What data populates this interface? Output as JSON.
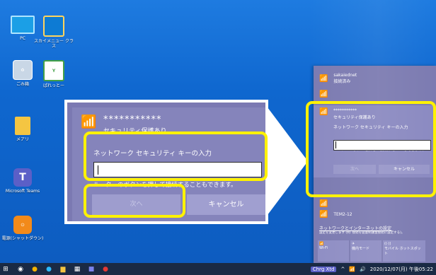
{
  "desktop": {
    "icons": [
      {
        "label": "PC",
        "icon": "pc-icon"
      },
      {
        "label": "スカイメニュー クラス",
        "icon": "sky-menu-icon"
      },
      {
        "label": "ごみ箱",
        "icon": "recycle-bin-icon"
      },
      {
        "label": "ぱれっとー",
        "icon": "green-app-icon"
      },
      {
        "label": "メアリ",
        "icon": "folder-icon"
      },
      {
        "label": "Microsoft Teams",
        "icon": "teams-icon"
      },
      {
        "label": "電源(シャットダウン)",
        "icon": "power-icon"
      }
    ]
  },
  "flyout": {
    "networks": [
      {
        "name": "sakaiednet",
        "status": "接続済み"
      },
      {
        "name": "TEM2-12",
        "status": ""
      }
    ],
    "selected": {
      "ssid": "***********",
      "security": "セキュリティ保護あり",
      "prompt": "ネットワーク セキュリティ キーの入力",
      "hint": "ルーターのボタンを押して接続することもできます。",
      "next": "次へ",
      "cancel": "キャンセル"
    },
    "settings_link": "ネットワークとインターネットの設定",
    "settings_sub": "設定を変更します (例: 接続を従量制課金接続に設定する)。",
    "tiles": [
      "Wi-Fi",
      "機内モード",
      "モバイル ホットスポット"
    ]
  },
  "panel": {
    "ssid": "***********",
    "security": "セキュリティ保護あり",
    "prompt": "ネットワーク セキュリティ キーの入力",
    "key_value": "",
    "hint": "ルーターのボタンを押して接続することもできます。",
    "next": "次へ",
    "cancel": "キャンセル"
  },
  "taskbar": {
    "ime": "Chrg Xtd",
    "datetime": "2020/12/07(月) 午後05:22"
  },
  "colors": {
    "highlight": "#fff200",
    "flyout_bg": "#7c7bb1",
    "desktop_bg": "#0f67cf"
  }
}
